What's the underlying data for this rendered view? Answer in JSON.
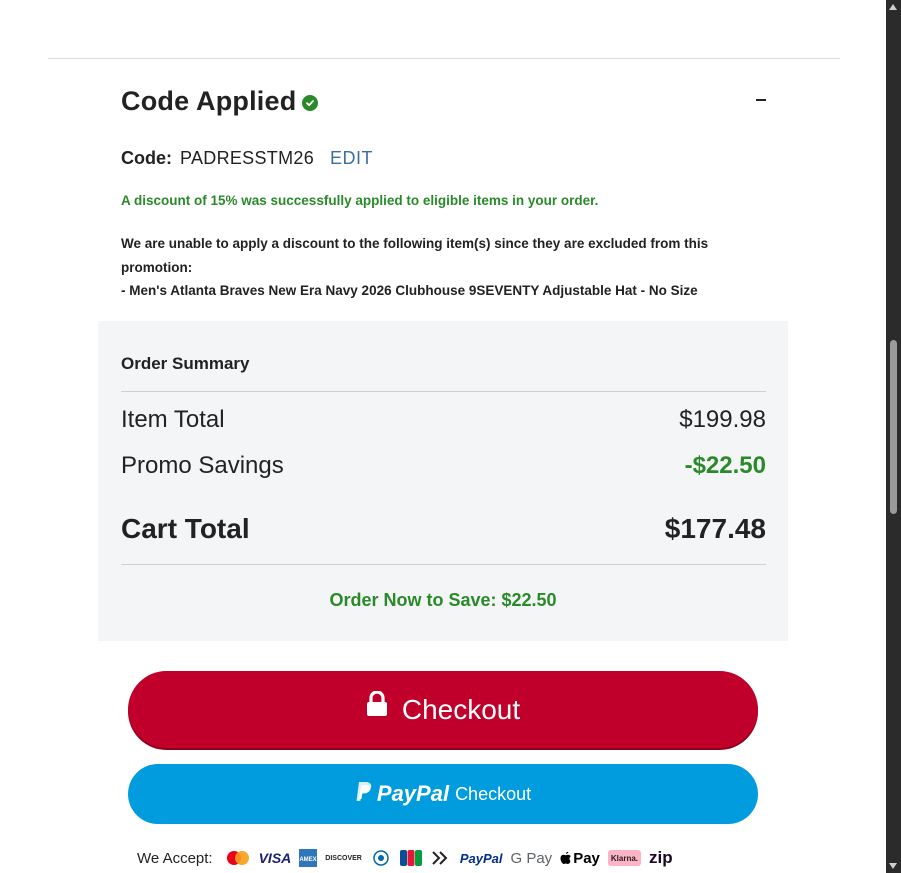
{
  "promo": {
    "title": "Code Applied",
    "code_label": "Code:",
    "code_value": "PADRESSTM26",
    "edit_label": "EDIT",
    "success_message": "A discount of 15% was successfully applied to eligible items in your order.",
    "excluded_message": "We are unable to apply a discount to the following item(s) since they are excluded from this promotion:",
    "excluded_item": "- Men's Atlanta Braves New Era Navy 2026 Clubhouse 9SEVENTY Adjustable Hat - No Size"
  },
  "summary": {
    "title": "Order Summary",
    "item_total_label": "Item Total",
    "item_total_value": "$199.98",
    "promo_savings_label": "Promo Savings",
    "promo_savings_value": "-$22.50",
    "cart_total_label": "Cart Total",
    "cart_total_value": "$177.48",
    "save_label": "Order Now to Save:",
    "save_value": "$22.50"
  },
  "buttons": {
    "checkout_label": "Checkout",
    "paypal_brand": "PayPal",
    "paypal_label": "Checkout"
  },
  "payments": {
    "accept_label": "We Accept:",
    "methods": [
      "mastercard",
      "VISA",
      "amex",
      "DISCOVER",
      "diners",
      "JCB",
      "affirm",
      "PayPal",
      "G Pay",
      "Pay",
      "Klarna.",
      "zip"
    ]
  },
  "colors": {
    "accent_red": "#c0002a",
    "paypal_blue": "#009cde",
    "success_green": "#2a8a2a",
    "summary_bg": "#f4f5f6"
  }
}
